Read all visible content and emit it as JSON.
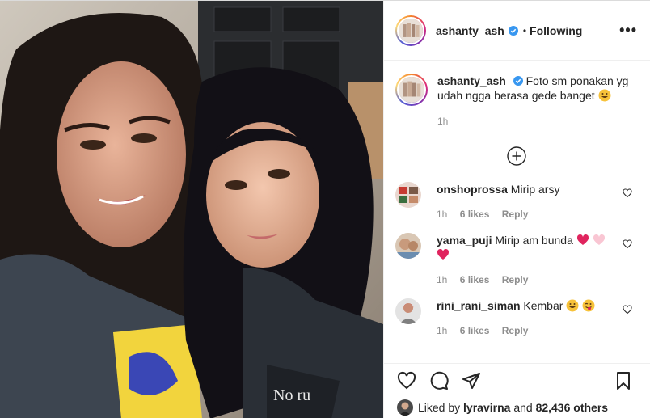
{
  "header": {
    "username": "ashanty_ash",
    "dot": "•",
    "follow_state": "Following",
    "more_label": "•••"
  },
  "caption": {
    "username": "ashanty_ash",
    "text": "Foto sm ponakan yg udah ngga berasa gede banget",
    "time": "1h"
  },
  "comments": [
    {
      "username": "onshoprossa",
      "text": "Mirip arsy",
      "time": "1h",
      "likes": "6 likes",
      "reply": "Reply"
    },
    {
      "username": "yama_puji",
      "text": "Mirip am bunda",
      "time": "1h",
      "likes": "6 likes",
      "reply": "Reply"
    },
    {
      "username": "rini_rani_siman",
      "text": "Kembar",
      "time": "1h",
      "likes": "6 likes",
      "reply": "Reply"
    }
  ],
  "liked_by": {
    "prefix": "Liked by",
    "user": "lyravirna",
    "middle": "and",
    "count": "82,436 others"
  },
  "photo_text": "No ru"
}
